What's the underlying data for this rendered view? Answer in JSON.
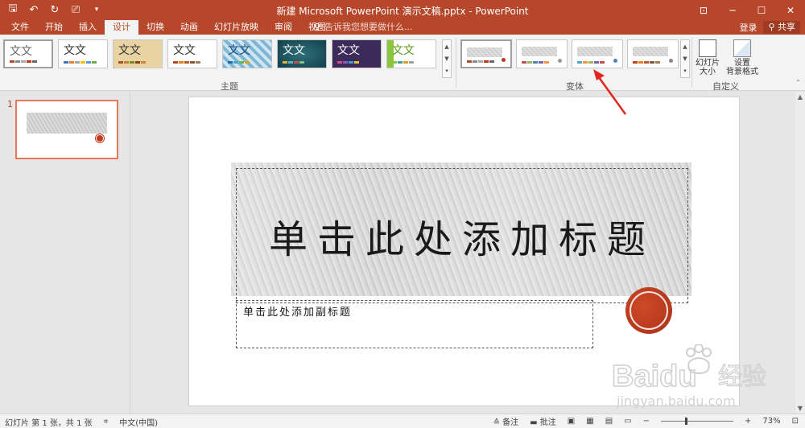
{
  "titlebar": {
    "title": "新建 Microsoft PowerPoint 演示文稿.pptx - PowerPoint",
    "bg_color": "#b7472a"
  },
  "qat": {
    "save": "🖫",
    "undo": "↶",
    "redo": "↻",
    "present": "⎚",
    "more": "▾"
  },
  "window_controls": {
    "ribbon_display": "⊡",
    "minimize": "─",
    "maximize": "☐",
    "close": "✕"
  },
  "tabs": [
    {
      "label": "文件"
    },
    {
      "label": "开始"
    },
    {
      "label": "插入"
    },
    {
      "label": "设计"
    },
    {
      "label": "切换"
    },
    {
      "label": "动画"
    },
    {
      "label": "幻灯片放映"
    },
    {
      "label": "审阅"
    },
    {
      "label": "视图"
    }
  ],
  "active_tab": "设计",
  "tellme": {
    "placeholder": "告诉我您想要做什么..."
  },
  "account": {
    "login": "登录",
    "share": "共享"
  },
  "ribbon": {
    "themes_group_label": "主题",
    "variants_group_label": "变体",
    "customize_group_label": "自定义",
    "theme_sample_text": "文文",
    "slide_size_label": "幻灯片\n大小",
    "slide_size_dropdown": "▾",
    "format_background_label": "设置\n背景格式",
    "collapse_icon": "ˆ"
  },
  "thumbnails": [
    {
      "number": "1"
    }
  ],
  "slide": {
    "title_placeholder": "单击此处添加标题",
    "subtitle_placeholder": "单击此处添加副标题",
    "seal_color": "#b83a1f"
  },
  "watermark": {
    "brand": "Baidu",
    "brand_cn": "经验",
    "url": "jingyan.baidu.com"
  },
  "statusbar": {
    "slide_info": "幻灯片 第 1 张，共 1 张",
    "language": "中文(中国)",
    "notes": "备注",
    "comments": "批注",
    "zoom": "73%",
    "zoom_minus": "−",
    "zoom_plus": "+"
  }
}
